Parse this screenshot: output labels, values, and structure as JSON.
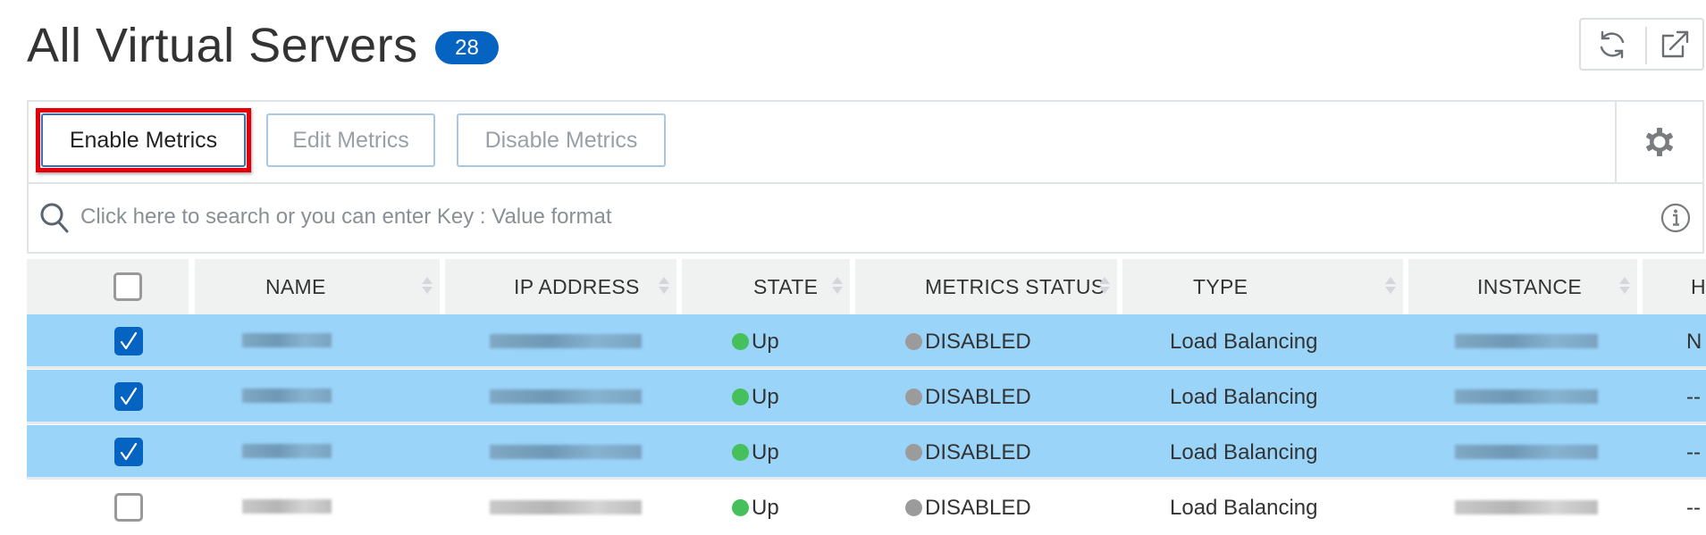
{
  "page": {
    "title": "All Virtual Servers",
    "count_badge": "28"
  },
  "header_actions": [
    {
      "name": "refresh",
      "icon": "refresh-icon"
    },
    {
      "name": "open-external",
      "icon": "external-link-icon"
    }
  ],
  "toolbar": {
    "enable_label": "Enable Metrics",
    "edit_label": "Edit Metrics",
    "disable_label": "Disable Metrics",
    "settings_icon": "gear-icon"
  },
  "search": {
    "placeholder": "Click here to search or you can enter Key : Value format",
    "value": "",
    "search_icon": "search-icon",
    "info_icon": "info-icon"
  },
  "table": {
    "columns": [
      "NAME",
      "IP ADDRESS",
      "STATE",
      "METRICS STATUS",
      "TYPE",
      "INSTANCE",
      "HO"
    ],
    "select_all_checked": false,
    "rows": [
      {
        "selected": true,
        "name": "[redacted]",
        "ip": "[redacted]",
        "state": "Up",
        "metrics_status": "DISABLED",
        "type": "Load Balancing",
        "instance": "[redacted]",
        "ho": "N"
      },
      {
        "selected": true,
        "name": "[redacted]",
        "ip": "[redacted]",
        "state": "Up",
        "metrics_status": "DISABLED",
        "type": "Load Balancing",
        "instance": "[redacted]",
        "ho": "--"
      },
      {
        "selected": true,
        "name": "[redacted]",
        "ip": "[redacted]",
        "state": "Up",
        "metrics_status": "DISABLED",
        "type": "Load Balancing",
        "instance": "[redacted]",
        "ho": "--"
      },
      {
        "selected": false,
        "name": "[redacted]",
        "ip": "[redacted]",
        "state": "Up",
        "metrics_status": "DISABLED",
        "type": "Load Balancing",
        "instance": "[redacted]",
        "ho": "--"
      }
    ]
  },
  "colors": {
    "accent": "#0563c1",
    "selected_row": "#9ad4f9",
    "state_up": "#45c05c",
    "metrics_disabled": "#9b9b9b",
    "highlight_box": "#e3000b"
  }
}
